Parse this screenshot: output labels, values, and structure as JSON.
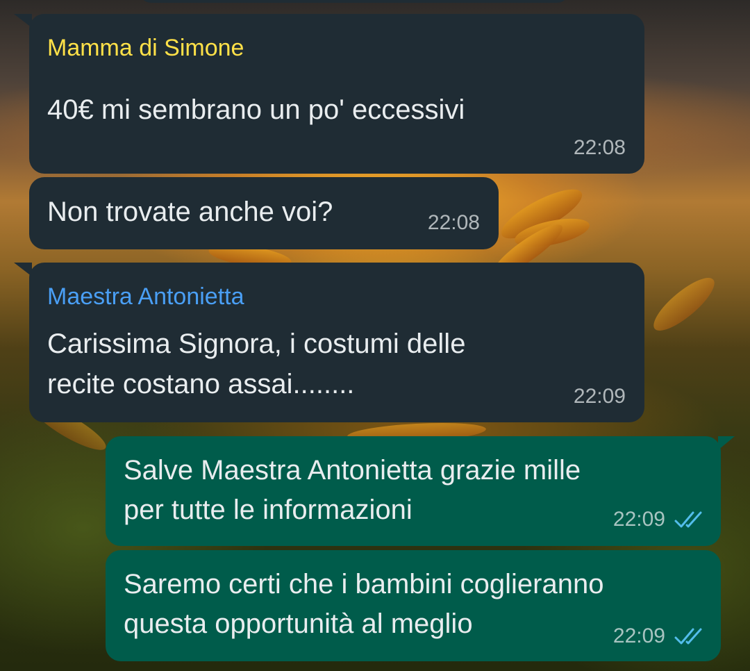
{
  "colors": {
    "incoming_bubble": "#1f2c34",
    "outgoing_bubble": "#005c4b",
    "sender_mamma": "#ffe148",
    "sender_maestra": "#4a9ff5",
    "read_ticks": "#53bdeb"
  },
  "messages": [
    {
      "direction": "incoming",
      "sender": "Mamma di Simone",
      "lines": [
        "40€ mi sembrano un po' eccessivi"
      ],
      "time": "22:08"
    },
    {
      "direction": "incoming",
      "lines": [
        "Non trovate anche voi?"
      ],
      "time": "22:08"
    },
    {
      "direction": "incoming",
      "sender": "Maestra Antonietta",
      "lines": [
        "Carissima Signora, i costumi delle",
        "recite costano assai........"
      ],
      "time": "22:09"
    },
    {
      "direction": "outgoing",
      "lines": [
        "Salve Maestra Antonietta grazie mille",
        "per tutte le informazioni"
      ],
      "time": "22:09",
      "status_icon": "double-check-read-icon"
    },
    {
      "direction": "outgoing",
      "lines": [
        "Saremo certi che i bambini coglieranno",
        "questa opportunità al meglio"
      ],
      "time": "22:09",
      "status_icon": "double-check-read-icon"
    }
  ]
}
